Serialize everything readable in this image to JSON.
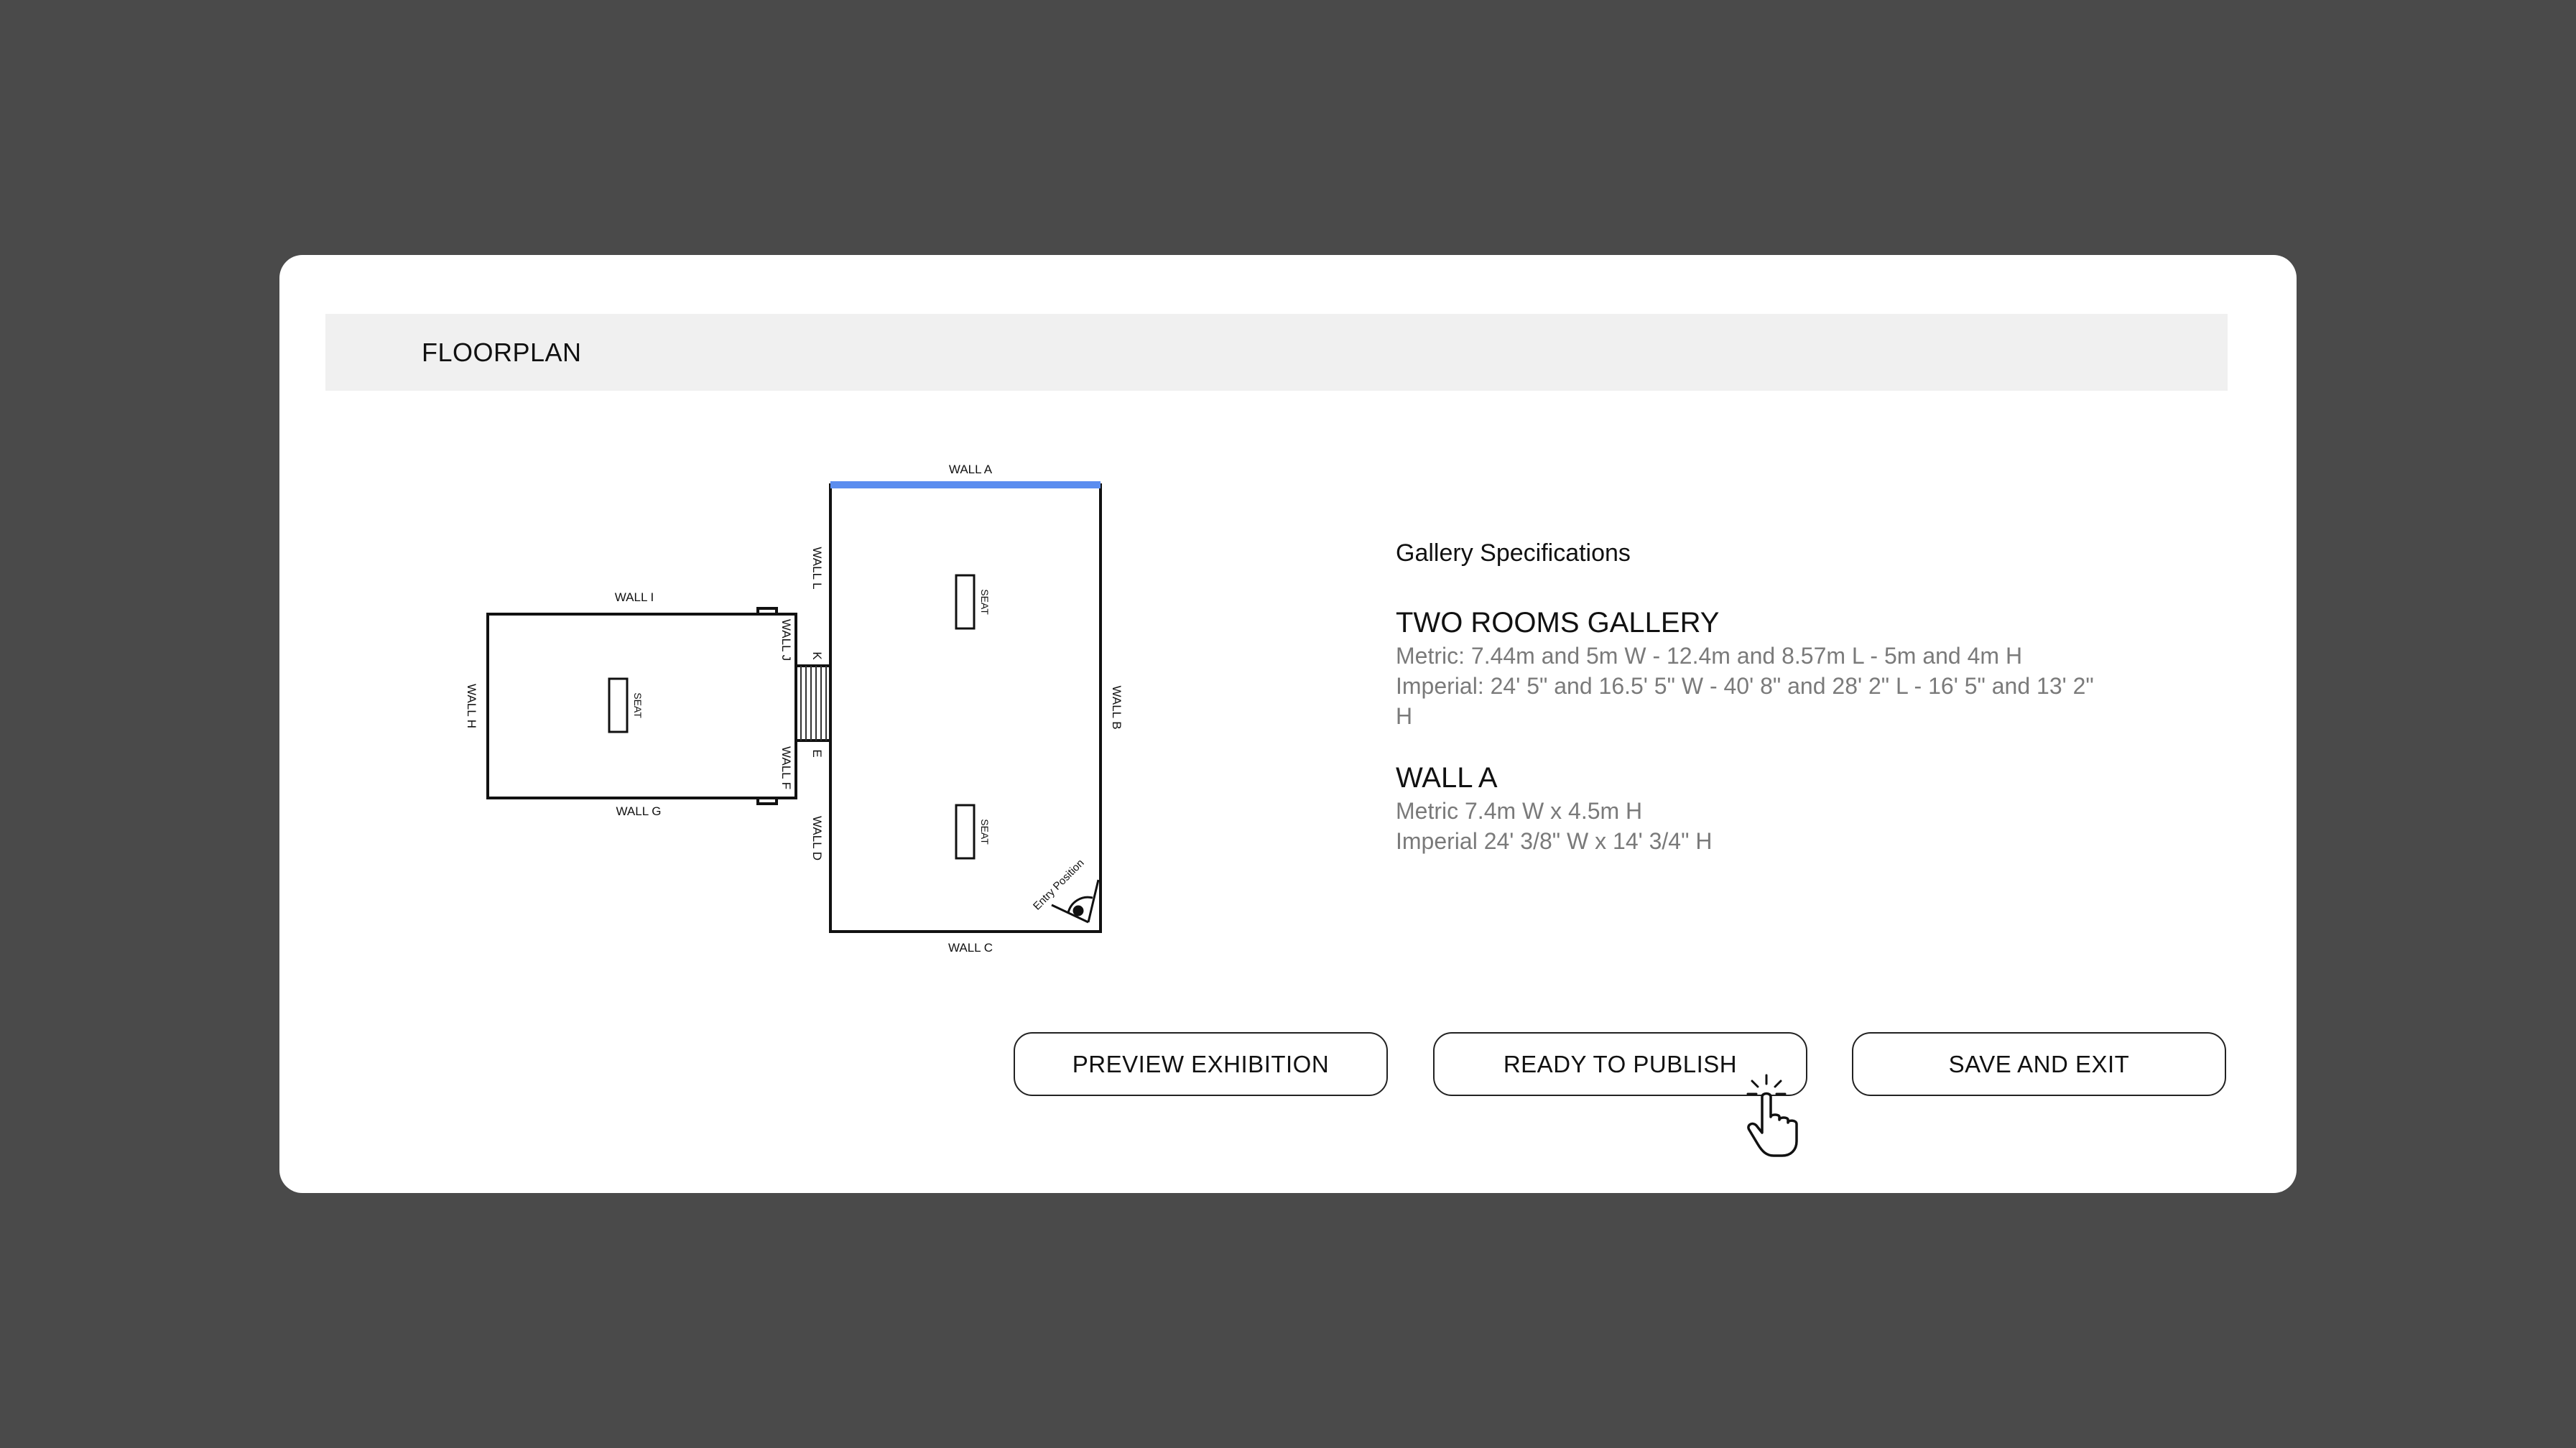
{
  "header": {
    "title": "FLOORPLAN"
  },
  "floorplan": {
    "labels": {
      "wall_a": "WALL A",
      "wall_b": "WALL B",
      "wall_c": "WALL C",
      "wall_d": "WALL D",
      "wall_e": "E",
      "wall_f": "WALL F",
      "wall_g": "WALL G",
      "wall_h": "WALL H",
      "wall_i": "WALL I",
      "wall_j": "WALL J",
      "wall_k": "K",
      "wall_l": "WALL L",
      "seat": "SEAT",
      "entry": "Entry Position"
    },
    "selected_wall_color": "#5b8def"
  },
  "specs": {
    "heading": "Gallery Specifications",
    "gallery": {
      "title": "TWO ROOMS GALLERY",
      "metric": "Metric: 7.44m and 5m W - 12.4m and 8.57m L - 5m and 4m H",
      "imperial_1": "Imperial: 24' 5\" and 16.5' 5\" W - 40' 8\" and 28' 2\" L - 16' 5\" and 13' 2\"",
      "imperial_2": "H"
    },
    "wall": {
      "title": "WALL A",
      "metric": "Metric 7.4m W x 4.5m H",
      "imperial": "Imperial 24' 3/8\" W x 14' 3/4\" H"
    }
  },
  "buttons": {
    "preview": "PREVIEW EXHIBITION",
    "publish": "READY TO PUBLISH",
    "save": "SAVE AND EXIT"
  },
  "icons": {
    "cursor": "hand-pointer-click-icon"
  }
}
